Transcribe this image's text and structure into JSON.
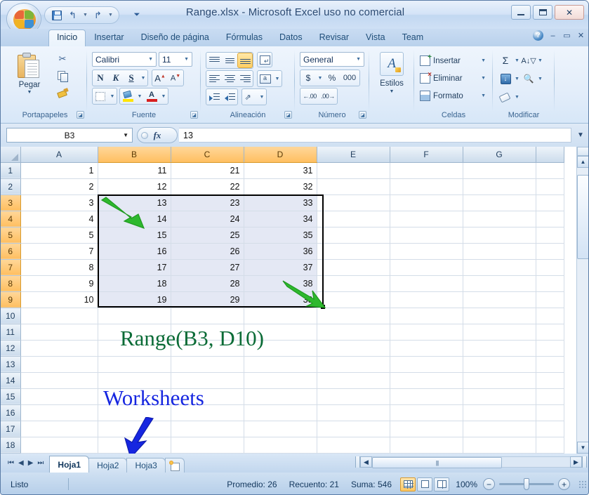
{
  "window": {
    "title": "Range.xlsx - Microsoft Excel uso no comercial",
    "minimize": "minimize-icon",
    "maximize": "maximize-icon",
    "close": "✕"
  },
  "quick_access": {
    "save": "save-icon",
    "undo": "↰",
    "redo": "↱",
    "customize": "▼"
  },
  "ribbon": {
    "tabs": [
      {
        "label": "Inicio",
        "active": true
      },
      {
        "label": "Insertar",
        "active": false
      },
      {
        "label": "Diseño de página",
        "active": false
      },
      {
        "label": "Fórmulas",
        "active": false
      },
      {
        "label": "Datos",
        "active": false
      },
      {
        "label": "Revisar",
        "active": false
      },
      {
        "label": "Vista",
        "active": false
      },
      {
        "label": "Team",
        "active": false
      }
    ],
    "help": "?",
    "win_min": "–",
    "win_restore": "▭",
    "win_close": "✕",
    "groups": {
      "clipboard": {
        "label": "Portapapeles",
        "paste": "Pegar",
        "paste_arrow": "▼",
        "cut": "✂",
        "copy": "copy-icon",
        "format_painter": "format-painter-icon",
        "launcher": "◪"
      },
      "font": {
        "label": "Fuente",
        "font_name": "Calibri",
        "font_size": "11",
        "bold": "N",
        "italic": "K",
        "underline": "S",
        "underline_arrow": "▼",
        "grow_font": "A",
        "shrink_font": "A",
        "borders_arrow": "▼",
        "fill_arrow": "▼",
        "fontcolor": "A",
        "fontcolor_arrow": "▼",
        "launcher": "◪"
      },
      "alignment": {
        "label": "Alineación",
        "wrap_text": "wrap-text-icon",
        "merge_arrow": "▼",
        "orient_arrow": "▼",
        "launcher": "◪"
      },
      "number": {
        "label": "Número",
        "format": "General",
        "currency": "$",
        "currency_arrow": "▼",
        "percent": "%",
        "comma": "000",
        "inc_dec": "inc-decimal-icon",
        "dec_dec": "dec-decimal-icon",
        "launcher": "◪"
      },
      "styles": {
        "label": "Estilos",
        "button": "Estilos",
        "arrow": "▼"
      },
      "cells": {
        "label": "Celdas",
        "items": [
          {
            "label": "Insertar",
            "arrow": "▼"
          },
          {
            "label": "Eliminar",
            "arrow": "▼"
          },
          {
            "label": "Formato",
            "arrow": "▼"
          }
        ]
      },
      "modify": {
        "label": "Modificar",
        "autosum": "Σ",
        "autosum_arrow": "▼",
        "sort": "sort-filter-icon",
        "sort_arrow": "▼",
        "fill": "fill-down-icon",
        "fill_arrow": "▼",
        "find": "find-icon",
        "find_arrow": "▼",
        "clear": "clear-icon",
        "clear_arrow": "▼"
      }
    }
  },
  "formula_bar": {
    "name_box": "B3",
    "name_box_arrow": "▼",
    "fx": "fx",
    "value": "13",
    "expand": "▼"
  },
  "grid": {
    "columns": [
      "A",
      "B",
      "C",
      "D",
      "E",
      "F",
      "G"
    ],
    "selected_columns": [
      "B",
      "C",
      "D"
    ],
    "rows": [
      1,
      2,
      3,
      4,
      5,
      6,
      7,
      8,
      9,
      10,
      11,
      12,
      13,
      14,
      15,
      16,
      17,
      18
    ],
    "selected_rows": [
      3,
      4,
      5,
      6,
      7,
      8,
      9
    ],
    "data": [
      {
        "row": 1,
        "A": "1",
        "B": "11",
        "C": "21",
        "D": "31",
        "E": "",
        "F": "",
        "G": ""
      },
      {
        "row": 2,
        "A": "2",
        "B": "12",
        "C": "22",
        "D": "32",
        "E": "",
        "F": "",
        "G": ""
      },
      {
        "row": 3,
        "A": "3",
        "B": "13",
        "C": "23",
        "D": "33",
        "E": "",
        "F": "",
        "G": ""
      },
      {
        "row": 4,
        "A": "4",
        "B": "14",
        "C": "24",
        "D": "34",
        "E": "",
        "F": "",
        "G": ""
      },
      {
        "row": 5,
        "A": "5",
        "B": "15",
        "C": "25",
        "D": "35",
        "E": "",
        "F": "",
        "G": ""
      },
      {
        "row": 6,
        "A": "7",
        "B": "16",
        "C": "26",
        "D": "36",
        "E": "",
        "F": "",
        "G": ""
      },
      {
        "row": 7,
        "A": "8",
        "B": "17",
        "C": "27",
        "D": "37",
        "E": "",
        "F": "",
        "G": ""
      },
      {
        "row": 8,
        "A": "9",
        "B": "18",
        "C": "28",
        "D": "38",
        "E": "",
        "F": "",
        "G": ""
      },
      {
        "row": 9,
        "A": "10",
        "B": "19",
        "C": "29",
        "D": "39",
        "E": "",
        "F": "",
        "G": ""
      },
      {
        "row": 10,
        "A": "",
        "B": "",
        "C": "",
        "D": "",
        "E": "",
        "F": "",
        "G": ""
      },
      {
        "row": 11,
        "A": "",
        "B": "",
        "C": "",
        "D": "",
        "E": "",
        "F": "",
        "G": ""
      },
      {
        "row": 12,
        "A": "",
        "B": "",
        "C": "",
        "D": "",
        "E": "",
        "F": "",
        "G": ""
      },
      {
        "row": 13,
        "A": "",
        "B": "",
        "C": "",
        "D": "",
        "E": "",
        "F": "",
        "G": ""
      },
      {
        "row": 14,
        "A": "",
        "B": "",
        "C": "",
        "D": "",
        "E": "",
        "F": "",
        "G": ""
      },
      {
        "row": 15,
        "A": "",
        "B": "",
        "C": "",
        "D": "",
        "E": "",
        "F": "",
        "G": ""
      },
      {
        "row": 16,
        "A": "",
        "B": "",
        "C": "",
        "D": "",
        "E": "",
        "F": "",
        "G": ""
      },
      {
        "row": 17,
        "A": "",
        "B": "",
        "C": "",
        "D": "",
        "E": "",
        "F": "",
        "G": ""
      },
      {
        "row": 18,
        "A": "",
        "B": "",
        "C": "",
        "D": "",
        "E": "",
        "F": "",
        "G": ""
      }
    ]
  },
  "annotations": {
    "range_label": "Range(B3, D10)",
    "range_color": "#0a6b36",
    "worksheets_label": "Worksheets",
    "worksheets_color": "#1626e0",
    "arrow_green": "green-arrow",
    "arrow_blue": "blue-arrow"
  },
  "sheet_tabs": {
    "first": "⏮",
    "prev": "◀",
    "next": "▶",
    "last": "⏭",
    "tabs": [
      {
        "label": "Hoja1",
        "active": true
      },
      {
        "label": "Hoja2",
        "active": false
      },
      {
        "label": "Hoja3",
        "active": false
      }
    ],
    "new_sheet": "new-sheet-icon"
  },
  "scrollbars": {
    "h_left": "◀",
    "h_right": "▶",
    "v_up": "▲",
    "v_down": "▼"
  },
  "status_bar": {
    "mode": "Listo",
    "average": "Promedio: 26",
    "count": "Recuento: 21",
    "sum": "Suma: 546",
    "view_normal": "normal-view-icon",
    "view_layout": "page-layout-icon",
    "view_break": "page-break-icon",
    "zoom": "100%",
    "zoom_out": "−",
    "zoom_in": "+"
  }
}
